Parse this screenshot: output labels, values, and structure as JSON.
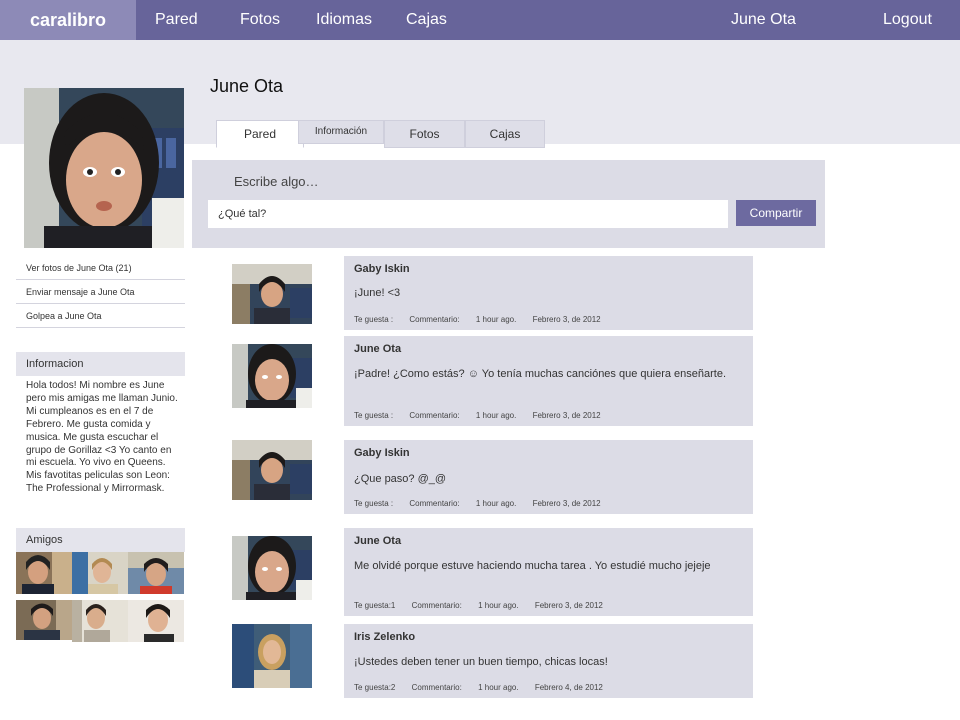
{
  "brand": "caralibro",
  "nav": {
    "links": [
      "Pared",
      "Fotos",
      "Idiomas",
      "Cajas"
    ],
    "user": "June Ota",
    "logout": "Logout"
  },
  "profile": {
    "name": "June Ota",
    "tabs": [
      "Pared",
      "Información",
      "Fotos",
      "Cajas"
    ],
    "active_tab": "Pared"
  },
  "composer": {
    "label": "Escribe algo…",
    "input_value": "¿Qué tal?",
    "button": "Compartir"
  },
  "sidebar": {
    "links": [
      "Ver fotos de June Ota (21)",
      "Enviar mensaje a June Ota",
      "Golpea a June Ota"
    ],
    "info_title": "Informacion",
    "info_text": "Hola todos! Mi nombre es June pero mis amigas me llaman Junio. Mi cumpleanos es en el 7 de Febrero. Me gusta comida y musica. Me gusta escuchar el grupo de Gorillaz <3  Yo canto en mi escuela. Yo vivo en Queens. Mis favotitas peliculas son Leon: The Professional y Mirrormask.",
    "friends_title": "Amigos"
  },
  "posts": [
    {
      "author": "Gaby Iskin",
      "text": "¡June! <3",
      "likes": "Te guesta :",
      "comment": "Commentario:",
      "ago": "1 hour ago.",
      "date": "Febrero 3, de 2012"
    },
    {
      "author": "June Ota",
      "text": "¡Padre! ¿Como estás? ☺ Yo tenía muchas canciónes que quiera enseñarte.",
      "likes": "Te guesta :",
      "comment": "Commentario:",
      "ago": "1 hour ago.",
      "date": "Febrero 3, de 2012"
    },
    {
      "author": "Gaby Iskin",
      "text": "¿Que paso?  @_@",
      "likes": "Te guesta :",
      "comment": "Commentario:",
      "ago": "1 hour ago.",
      "date": "Febrero 3, de 2012"
    },
    {
      "author": "June Ota",
      "text": "Me olvidé porque estuve haciendo mucha tarea . Yo estudié mucho jejeje",
      "likes": "Te guesta:1",
      "comment": "Commentario:",
      "ago": "1 hour ago.",
      "date": "Febrero 3, de 2012"
    },
    {
      "author": "Iris Zelenko",
      "text": "¡Ustedes deben tener un buen tiempo, chicas locas!",
      "likes": "Te guesta:2",
      "comment": "Commentario:",
      "ago": "1 hour ago.",
      "date": "Febrero 4, de 2012"
    }
  ]
}
